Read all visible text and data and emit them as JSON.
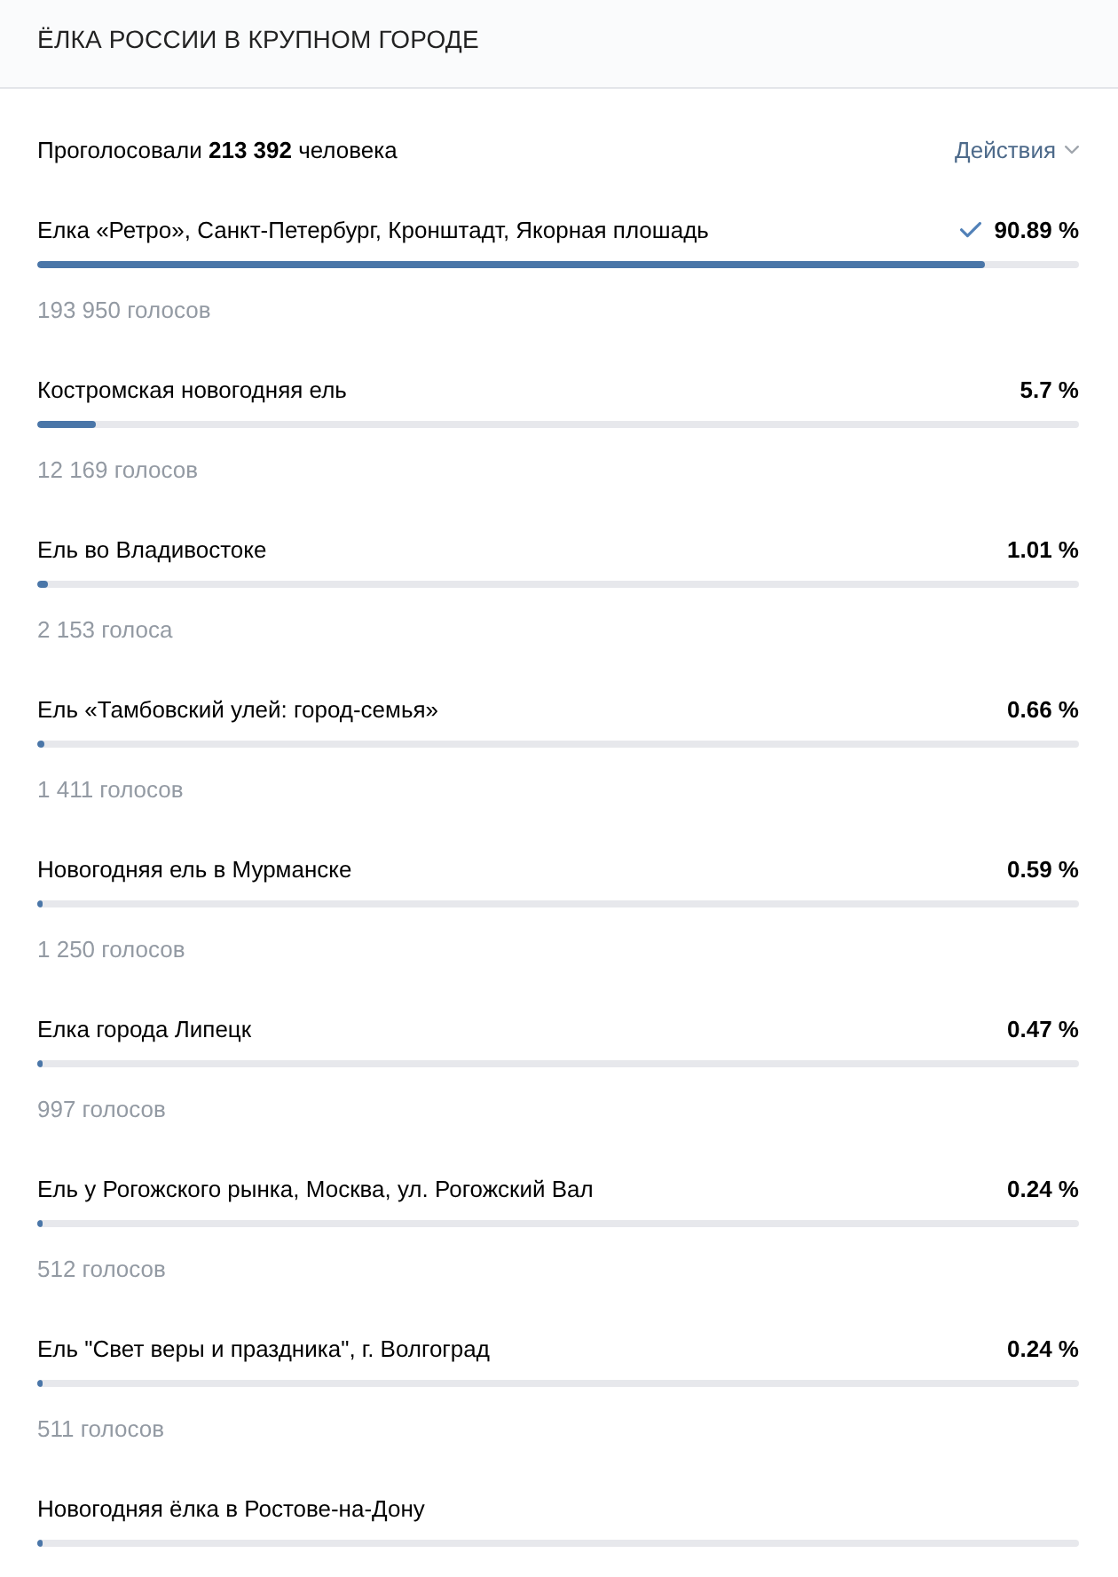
{
  "poll": {
    "title": "ЁЛКА РОССИИ В КРУПНОМ ГОРОДЕ",
    "summary": "Проголосовали **213 392** человека",
    "actions": "Действия",
    "options": [
      {
        "text": "Елка «Ретро», Санкт-Петербург, Кронштадт, Якорная плошадь",
        "percent": "90.89 %",
        "votes": "193 950 голосов",
        "level": 0.9089,
        "selected": true
      },
      {
        "text": "Костромская новогодняя ель",
        "percent": "5.7 %",
        "votes": "12 169 голосов",
        "level": 0.057,
        "selected": false
      },
      {
        "text": "Ель во Владивостоке",
        "percent": "1.01 %",
        "votes": "2 153 голоса",
        "level": 0.0101,
        "selected": false
      },
      {
        "text": "Ель «Тамбовский улей: город-семья»",
        "percent": "0.66 %",
        "votes": "1 411 голосов",
        "level": 0.0066,
        "selected": false
      },
      {
        "text": "Новогодняя ель в Мурманске",
        "percent": "0.59 %",
        "votes": "1 250 голосов",
        "level": 0.0059,
        "selected": false
      },
      {
        "text": "Елка города Липецк",
        "percent": "0.47 %",
        "votes": "997 голосов",
        "level": 0.0047,
        "selected": false
      },
      {
        "text": "Ель у Рогожского рынка, Москва, ул. Рогожский Вал",
        "percent": "0.24 %",
        "votes": "512 голосов",
        "level": 0.0024,
        "selected": false
      },
      {
        "text": "Ель \"Свет веры и праздника\", г. Волгоград",
        "percent": "0.24 %",
        "votes": "511 голосов",
        "level": 0.0024,
        "selected": false
      },
      {
        "text": "Новогодняя ёлка в Ростове-на-Дону",
        "level": 0.0022,
        "selected": false
      }
    ]
  }
}
